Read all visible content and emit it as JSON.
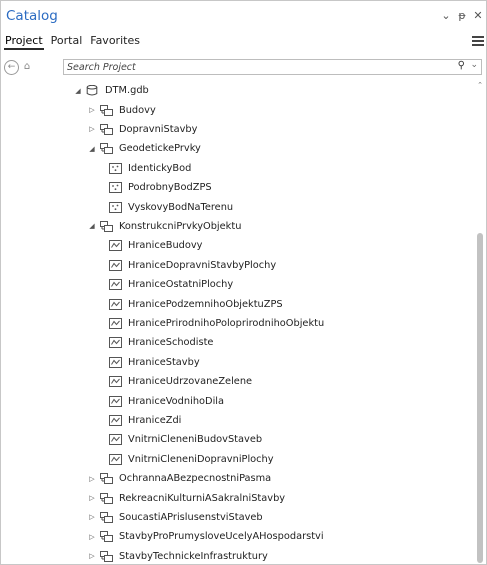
{
  "pane": {
    "title": "Catalog",
    "buttons": {
      "options": "⌄",
      "pin": "ᵽ",
      "close": "✕"
    }
  },
  "tabs": [
    {
      "label": "Project",
      "active": true
    },
    {
      "label": "Portal",
      "active": false
    },
    {
      "label": "Favorites",
      "active": false
    }
  ],
  "search": {
    "placeholder": "Search Project",
    "value": ""
  },
  "tree": [
    {
      "label": "DTM.gdb",
      "level": 0,
      "expanded": true,
      "icon": "geodatabase-icon"
    },
    {
      "label": "Budovy",
      "level": 1,
      "expanded": false,
      "icon": "feature-dataset-icon"
    },
    {
      "label": "DopravniStavby",
      "level": 1,
      "expanded": false,
      "icon": "feature-dataset-icon"
    },
    {
      "label": "GeodetickePrvky",
      "level": 1,
      "expanded": true,
      "icon": "feature-dataset-icon"
    },
    {
      "label": "IdentickyBod",
      "level": 2,
      "icon": "point-feature-class-icon"
    },
    {
      "label": "PodrobnyBodZPS",
      "level": 2,
      "icon": "point-feature-class-icon"
    },
    {
      "label": "VyskovyBodNaTerenu",
      "level": 2,
      "icon": "point-feature-class-icon"
    },
    {
      "label": "KonstrukcniPrvkyObjektu",
      "level": 1,
      "expanded": true,
      "icon": "feature-dataset-icon"
    },
    {
      "label": "HraniceBudovy",
      "level": 2,
      "icon": "line-feature-class-icon"
    },
    {
      "label": "HraniceDopravniStavbyPlochy",
      "level": 2,
      "icon": "line-feature-class-icon"
    },
    {
      "label": "HraniceOstatniPlochy",
      "level": 2,
      "icon": "line-feature-class-icon"
    },
    {
      "label": "HranicePodzemnihoObjektuZPS",
      "level": 2,
      "icon": "line-feature-class-icon"
    },
    {
      "label": "HranicePrirodnihoPoloprirodnihoObjektu",
      "level": 2,
      "icon": "line-feature-class-icon"
    },
    {
      "label": "HraniceSchodiste",
      "level": 2,
      "icon": "line-feature-class-icon"
    },
    {
      "label": "HraniceStavby",
      "level": 2,
      "icon": "line-feature-class-icon"
    },
    {
      "label": "HraniceUdrzovaneZelene",
      "level": 2,
      "icon": "line-feature-class-icon"
    },
    {
      "label": "HraniceVodnihoDila",
      "level": 2,
      "icon": "line-feature-class-icon"
    },
    {
      "label": "HraniceZdi",
      "level": 2,
      "icon": "line-feature-class-icon"
    },
    {
      "label": "VnitrniCleneniBudovStaveb",
      "level": 2,
      "icon": "line-feature-class-icon"
    },
    {
      "label": "VnitrniCleneniDopravniPlochy",
      "level": 2,
      "icon": "line-feature-class-icon"
    },
    {
      "label": "OchrannaABezpecnostniPasma",
      "level": 1,
      "expanded": false,
      "icon": "feature-dataset-icon"
    },
    {
      "label": "RekreacniKulturniASakralniStavby",
      "level": 1,
      "expanded": false,
      "icon": "feature-dataset-icon"
    },
    {
      "label": "SoucastiAPrislusenstviStaveb",
      "level": 1,
      "expanded": false,
      "icon": "feature-dataset-icon"
    },
    {
      "label": "StavbyProPrumysloveUcelyAHospodarstvi",
      "level": 1,
      "expanded": false,
      "icon": "feature-dataset-icon"
    },
    {
      "label": "StavbyTechnickeInfrastruktury",
      "level": 1,
      "expanded": false,
      "icon": "feature-dataset-icon"
    }
  ]
}
